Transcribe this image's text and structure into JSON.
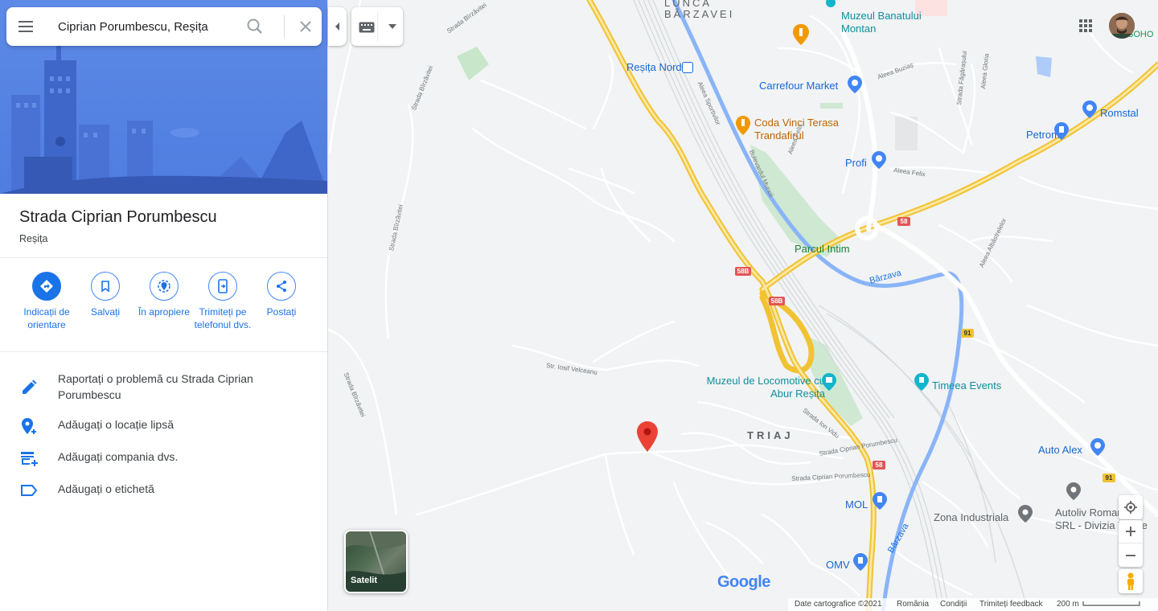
{
  "search": {
    "value": "Ciprian Porumbescu, Reșița"
  },
  "place": {
    "title": "Strada Ciprian Porumbescu",
    "subtitle": "Reșița"
  },
  "actions": [
    {
      "label": "Indicații de orientare",
      "icon": "directions-icon"
    },
    {
      "label": "Salvați",
      "icon": "bookmark-icon"
    },
    {
      "label": "În apropiere",
      "icon": "nearby-icon"
    },
    {
      "label": "Trimiteți pe telefonul dvs.",
      "icon": "send-to-phone-icon"
    },
    {
      "label": "Postați",
      "icon": "share-icon"
    }
  ],
  "options": [
    {
      "label": "Raportați o problemă cu Strada Ciprian Porumbescu",
      "icon": "pencil-icon"
    },
    {
      "label": "Adăugați o locație lipsă",
      "icon": "add-location-icon"
    },
    {
      "label": "Adăugați compania dvs.",
      "icon": "add-business-icon"
    },
    {
      "label": "Adăugați o etichetă",
      "icon": "label-icon"
    }
  ],
  "map": {
    "area_labels": {
      "lunca": "LUNCA",
      "barzavei": "BÂRZAVEI",
      "triaj": "TRIAJ"
    },
    "pois": {
      "muzeul_banatului": "Muzeul Banatului Montan",
      "resita_nord": "Reșița Nord",
      "carrefour": "Carrefour Market",
      "coda_vinci": "Coda Vinci Terasa Trandafirul",
      "profi": "Profi",
      "petrom": "Petrom",
      "romstal": "Romstal",
      "parcul_intim": "Parcul Intim",
      "muzeul_locomotive": "Muzeul de Locomotive cu Abur Reșița",
      "timeea": "Timeea Events",
      "auto_alex": "Auto Alex",
      "mol": "MOL",
      "zona_industriala": "Zona Industriala",
      "autoliv": "Autoliv Romania SRL - Divizia Textile",
      "omv": "OMV",
      "soho": "SOHO"
    },
    "streets": {
      "birzavitei_1": "Strada Bîrzăvitei",
      "birzavitei_2": "Strada Bîrzăvitei",
      "birzavitei_3": "Strada Bîrzăvitei",
      "birzavitei_4": "Strada Bîrzăvitei",
      "iosif_velceanu": "Str. Iosif Velceanu",
      "ciprian_porumbescu": "Strada Ciprian Porumbescu",
      "ciprian_porumbescu_2": "Strada Ciprian Porumbescu",
      "ion_vidu": "Strada Ion Vidu",
      "sportivilor": "Aleea Sportivilor",
      "bulevardul_muncii": "Bulevardul Muncii",
      "aleea_felix_1": "Aleea Felix",
      "aleea_felix_2": "Aleea Felix",
      "aleea_buzias": "Aleea Buziaș",
      "strada_fagaras": "Strada Făgărașului",
      "aleea_gloria": "Aleea Gloria",
      "aleea_albastrelelor": "Aleea Albăstrelelor"
    },
    "rivers": {
      "barzava_1": "Bârzava",
      "barzava_2": "Bârzava"
    },
    "route_shields": {
      "r58": "58",
      "r58b_1": "58B",
      "r58b_2": "58B",
      "r58_2": "58",
      "r91_1": "91",
      "r91_2": "91"
    },
    "satellite_label": "Satelit",
    "google": "Google",
    "attribution": {
      "data": "Date cartografice ©2021",
      "country": "România",
      "terms": "Condiții",
      "feedback": "Trimiteți feedback",
      "scale": "200 m"
    }
  }
}
